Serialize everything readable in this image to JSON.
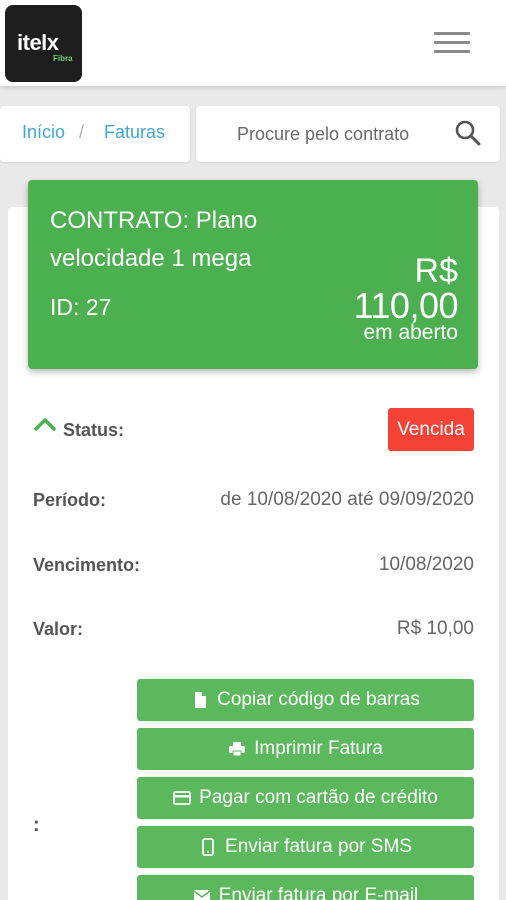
{
  "app": {
    "logo_text": "itelx",
    "logo_sub": "Fibra"
  },
  "breadcrumb": {
    "home": "Início",
    "separator": "/",
    "current": "Faturas"
  },
  "search": {
    "placeholder": "Procure pelo contrato"
  },
  "contract": {
    "title": "CONTRATO: Plano velocidade 1 mega",
    "id": "ID: 27",
    "currency": "R$",
    "amount": "110,00",
    "status_text": "em aberto"
  },
  "invoice": {
    "status_label": "Status:",
    "status_value": "Vencida",
    "period_label": "Período:",
    "period_value": "de 10/08/2020 até 09/09/2020",
    "due_label": "Vencimento:",
    "due_value": "10/08/2020",
    "value_label": "Valor:",
    "value_value": "R$ 10,00",
    "actions_label": ":"
  },
  "actions": [
    {
      "label": "Copiar código de barras",
      "icon": "file-icon"
    },
    {
      "label": "Imprimir Fatura",
      "icon": "printer-icon"
    },
    {
      "label": "Pagar com cartão de crédito",
      "icon": "credit-card-icon"
    },
    {
      "label": "Enviar fatura por SMS",
      "icon": "mobile-icon"
    },
    {
      "label": "Enviar fatura por E-mail",
      "icon": "envelope-icon"
    }
  ],
  "colors": {
    "brand_green": "#4caf50",
    "button_green": "#5cb85c",
    "overdue_red": "#f44336",
    "link_blue": "#3fa7d6"
  }
}
